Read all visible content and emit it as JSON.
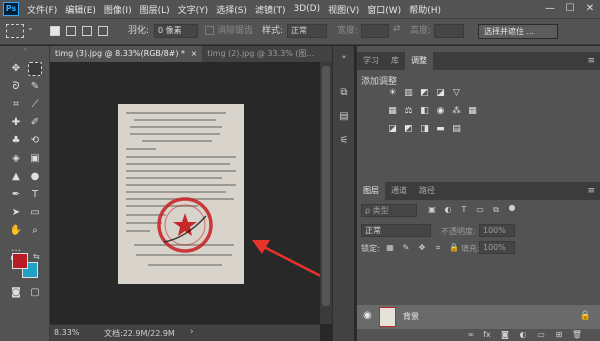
{
  "app": {
    "logo": "Ps"
  },
  "menu": [
    "文件(F)",
    "编辑(E)",
    "图像(I)",
    "图层(L)",
    "文字(Y)",
    "选择(S)",
    "滤镜(T)",
    "3D(D)",
    "视图(V)",
    "窗口(W)",
    "帮助(H)"
  ],
  "window_controls": {
    "minimize": "—",
    "maximize": "☐",
    "close": "✕"
  },
  "options": {
    "feather_label": "羽化:",
    "feather_value": "0 像素",
    "antialias_label": "消除锯齿",
    "style_label": "样式:",
    "style_value": "正常",
    "width_label": "宽度:",
    "height_label": "高度:",
    "select_mask_button": "选择并遮住 ..."
  },
  "doc_tabs": [
    {
      "label": "timg (3).jpg @ 8.33%(RGB/8#) *",
      "close": "×"
    },
    {
      "label": "timg (2).jpg @ 33.3% (图...",
      "close": ""
    }
  ],
  "status": {
    "zoom": "8.33%",
    "doc_size": "文档:22.9M/22.9M",
    "arrow": "›"
  },
  "panels": {
    "top_tabs": [
      "学习",
      "库",
      "调整"
    ],
    "adjust_title": "添加调整",
    "layer_tabs": [
      "图层",
      "通道",
      "路径"
    ],
    "filter_type": "ρ 类型",
    "blend_mode": "正常",
    "opacity_label": "不透明度:",
    "opacity_value": "100%",
    "lock_label": "锁定:",
    "fill_label": "填充:",
    "fill_value": "100%",
    "layer_name": "背景"
  },
  "document": {
    "stamp_color": "#c8282a",
    "arrow_color": "#e8332a"
  }
}
